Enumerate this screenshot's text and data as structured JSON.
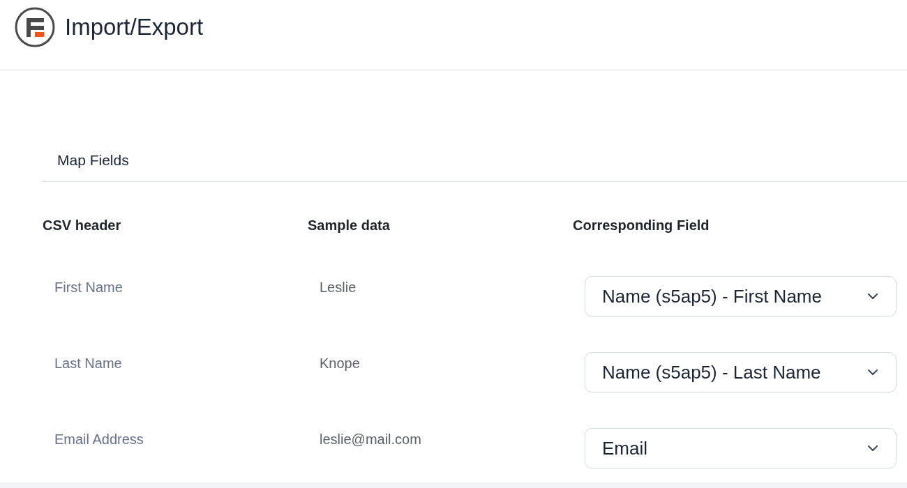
{
  "header": {
    "title": "Import/Export"
  },
  "section": {
    "title": "Map Fields"
  },
  "table": {
    "columns": [
      "CSV header",
      "Sample data",
      "Corresponding Field"
    ],
    "rows": [
      {
        "csv_header": "First Name",
        "sample_data": "Leslie",
        "field": "Name (s5ap5) - First Name"
      },
      {
        "csv_header": "Last Name",
        "sample_data": "Knope",
        "field": "Name (s5ap5) - Last Name"
      },
      {
        "csv_header": "Email Address",
        "sample_data": "leslie@mail.com",
        "field": "Email"
      }
    ]
  }
}
